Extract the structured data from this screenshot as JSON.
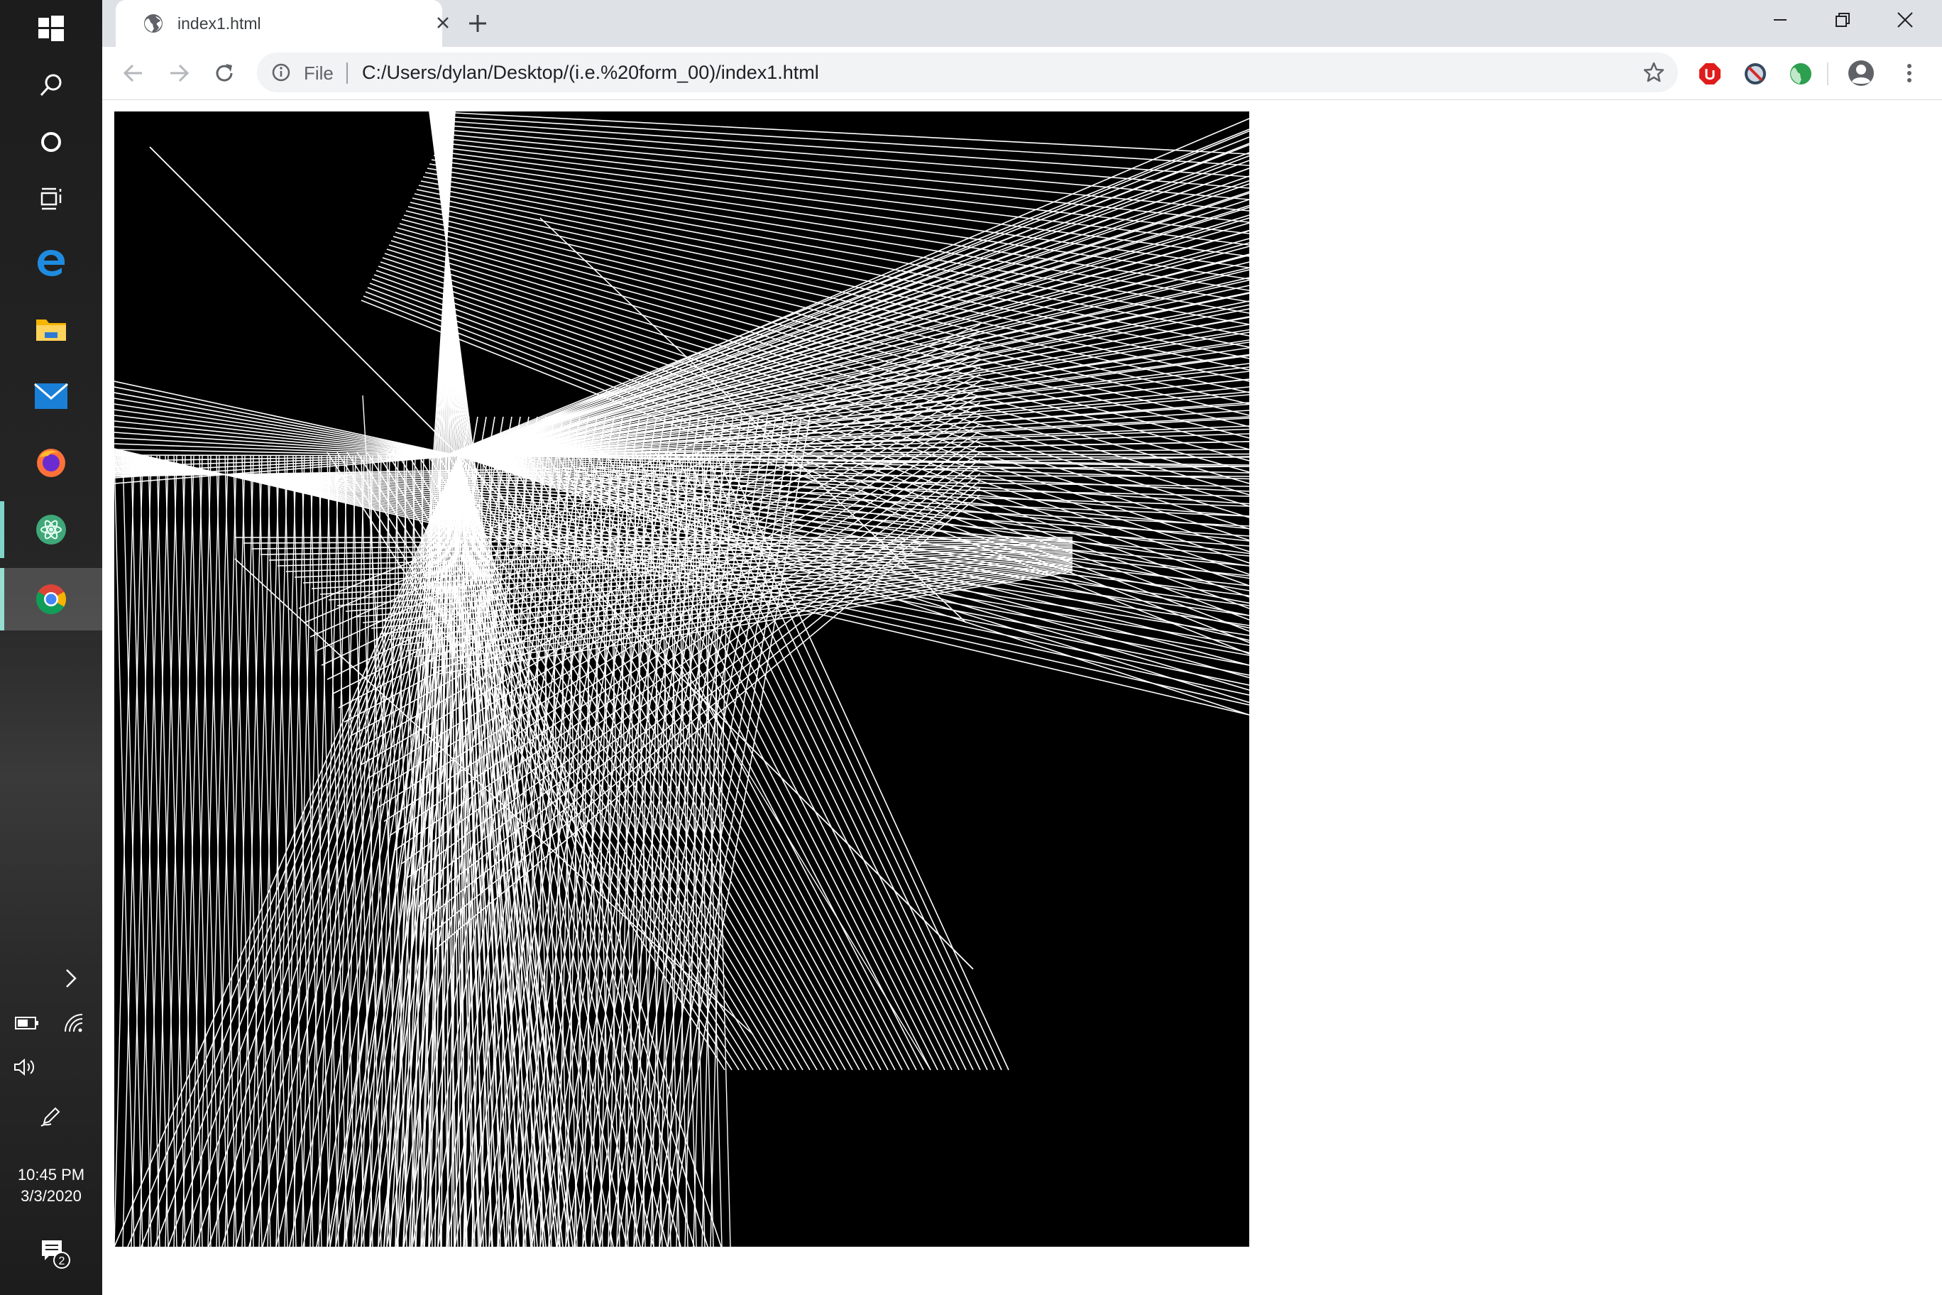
{
  "browser": {
    "tab": {
      "title": "index1.html",
      "favicon": "globe-icon"
    },
    "omnibox": {
      "scheme_label": "File",
      "url": "C:/Users/dylan/Desktop/(i.e.%20form_00)/index1.html"
    },
    "extensions": [
      "adblock-stop-icon",
      "blocker-icon",
      "globe-extension-icon"
    ]
  },
  "taskbar": {
    "pinned": [
      "windows-start-icon",
      "search-icon",
      "cortana-icon",
      "task-view-icon",
      "edge-icon",
      "file-explorer-icon",
      "mail-icon",
      "firefox-icon",
      "atom-icon",
      "chrome-icon"
    ],
    "tray": [
      "chevron-up-icon",
      "battery-icon",
      "wifi-icon",
      "volume-icon",
      "pen-icon"
    ],
    "clock_time": "10:45 PM",
    "clock_date": "3/3/2020",
    "notification_count": "2"
  },
  "colors": {
    "canvas_bg": "#000000",
    "line_color": "#ffffff",
    "tabstrip": "#dee1e6",
    "omnibox": "#f1f3f4",
    "taskbar_accent": "#7fd6c8"
  }
}
